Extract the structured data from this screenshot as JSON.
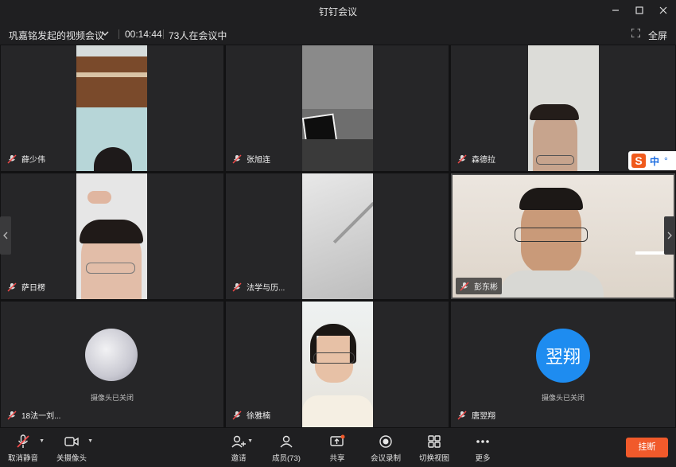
{
  "window": {
    "title": "钉钉会议",
    "controls": [
      "minimize-icon",
      "maximize-icon",
      "close-icon"
    ]
  },
  "meeting": {
    "title": "巩嘉铭发起的视频会议",
    "timer": "00:14:44",
    "participant_count": "73人在会议中",
    "fullscreen_label": "全屏"
  },
  "participants": [
    {
      "name": "薛少伟",
      "mic_muted": true,
      "camera_on": true
    },
    {
      "name": "张旭连",
      "mic_muted": true,
      "camera_on": true
    },
    {
      "name": "森德拉",
      "mic_muted": true,
      "camera_on": true
    },
    {
      "name": "萨日楞",
      "mic_muted": true,
      "camera_on": true
    },
    {
      "name": "法学与历...",
      "mic_muted": true,
      "camera_on": true
    },
    {
      "name": "彭东彬",
      "mic_muted": true,
      "camera_on": true
    },
    {
      "name": "18法一刘...",
      "mic_muted": true,
      "camera_on": false,
      "camera_off_label": "摄像头已关闭"
    },
    {
      "name": "徐雅楠",
      "mic_muted": true,
      "camera_on": true
    },
    {
      "name": "唐翌翔",
      "mic_muted": true,
      "camera_on": false,
      "camera_off_label": "摄像头已关闭",
      "avatar_text": "翌翔",
      "avatar_color": "#1e8cf0"
    }
  ],
  "ime": {
    "logo": "S",
    "mode": "中",
    "extra": "°"
  },
  "toolbar": {
    "mute_label": "取消静音",
    "camera_label": "关摄像头",
    "invite_label": "邀请",
    "members_label": "成员(73)",
    "share_label": "共享",
    "record_label": "会议录制",
    "switch_view_label": "切换视图",
    "more_label": "更多",
    "hangup_label": "挂断"
  },
  "colors": {
    "hangup": "#f15a2b",
    "avatar_blue": "#1e8cf0",
    "tile_bg": "#262628"
  }
}
